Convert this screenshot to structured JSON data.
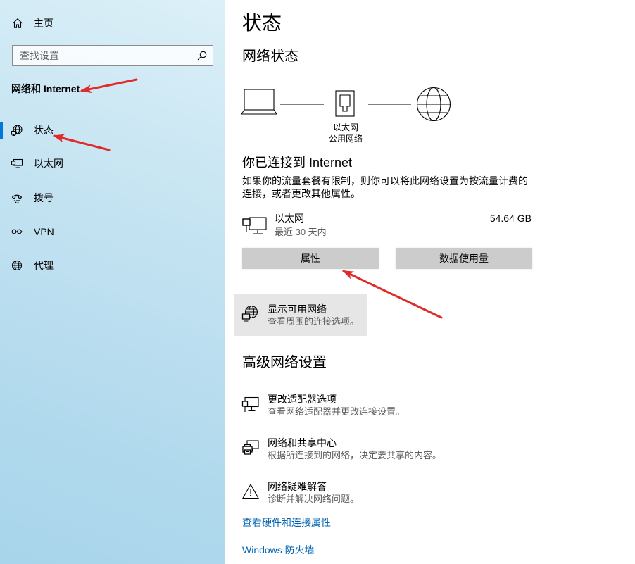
{
  "sidebar": {
    "home": {
      "label": "主页",
      "icon": "home-icon"
    },
    "search": {
      "placeholder": "查找设置",
      "icon": "search-icon"
    },
    "section_title": "网络和 Internet",
    "items": [
      {
        "label": "状态",
        "icon": "status-globe-icon",
        "selected": true
      },
      {
        "label": "以太网",
        "icon": "ethernet-icon",
        "selected": false
      },
      {
        "label": "拨号",
        "icon": "dialup-icon",
        "selected": false
      },
      {
        "label": "VPN",
        "icon": "vpn-icon",
        "selected": false
      },
      {
        "label": "代理",
        "icon": "proxy-globe-icon",
        "selected": false
      }
    ]
  },
  "main": {
    "title": "状态",
    "network_status": {
      "heading": "网络状态",
      "adapter_label": "以太网",
      "network_profile": "公用网络",
      "icons": [
        "laptop-icon",
        "ethernet-port-icon",
        "internet-globe-icon"
      ]
    },
    "connected": {
      "title": "你已连接到 Internet",
      "description_lines": [
        "如果你的流量套餐有限制，则你可以将此网络设置为按流量计费的",
        "连接，或者更改其他属性。"
      ]
    },
    "connection": {
      "name": "以太网",
      "period": "最近 30 天内",
      "data_used": "54.64 GB",
      "icon": "ethernet-adapter-icon"
    },
    "buttons": {
      "properties": "属性",
      "data_usage": "数据使用量"
    },
    "show_networks": {
      "title": "显示可用网络",
      "description": "查看周围的连接选项。",
      "icon": "available-networks-icon"
    },
    "advanced": {
      "heading": "高级网络设置",
      "items": [
        {
          "title": "更改适配器选项",
          "description": "查看网络适配器并更改连接设置。",
          "icon": "adapter-icon"
        },
        {
          "title": "网络和共享中心",
          "description": "根据所连接到的网络，决定要共享的内容。",
          "icon": "sharing-center-icon"
        },
        {
          "title": "网络疑难解答",
          "description": "诊断并解决网络问题。",
          "icon": "warning-icon"
        }
      ]
    },
    "links": [
      {
        "label": "查看硬件和连接属性"
      },
      {
        "label": "Windows 防火墙"
      }
    ]
  },
  "colors": {
    "accent": "#0078d7",
    "link": "#0063b1",
    "annotation_arrow": "#e02b2b",
    "button_bg": "#cccccc",
    "highlight_bg": "#e6e6e6"
  }
}
